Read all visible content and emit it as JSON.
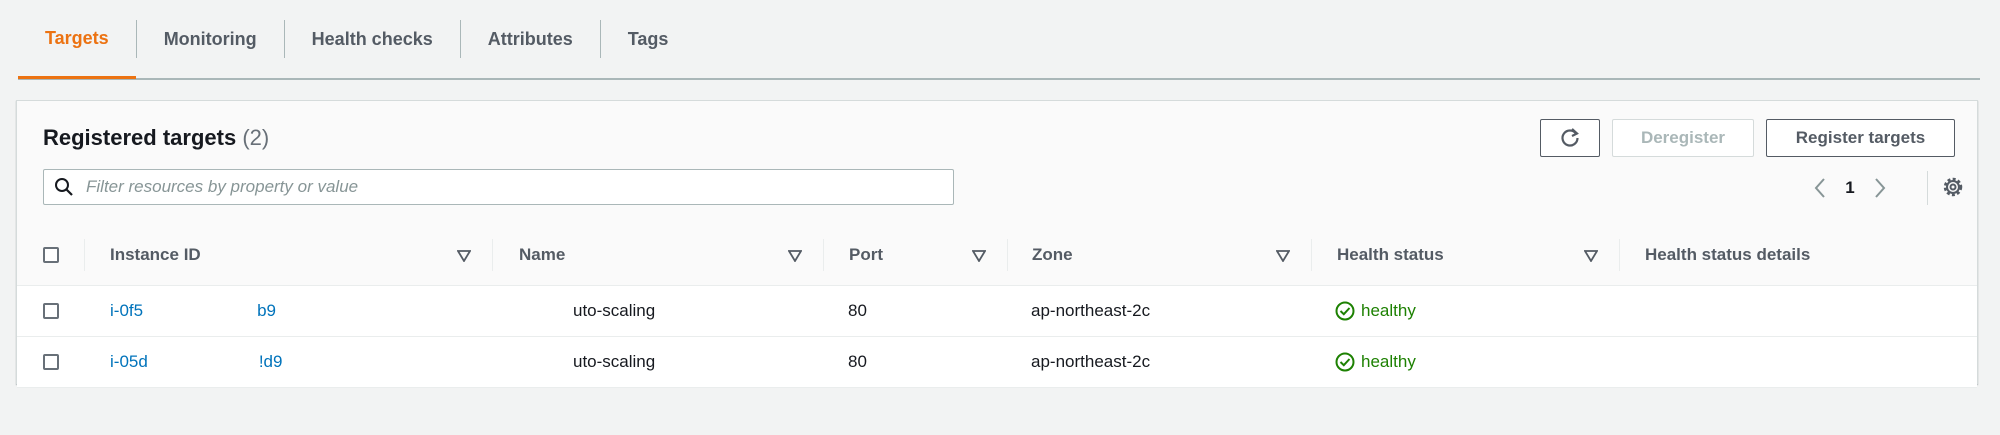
{
  "tabs": [
    {
      "label": "Targets",
      "active": true
    },
    {
      "label": "Monitoring",
      "active": false
    },
    {
      "label": "Health checks",
      "active": false
    },
    {
      "label": "Attributes",
      "active": false
    },
    {
      "label": "Tags",
      "active": false
    }
  ],
  "panel": {
    "title": "Registered targets",
    "count": "(2)"
  },
  "buttons": {
    "refresh_icon": "refresh-icon",
    "deregister": "Deregister",
    "register": "Register targets"
  },
  "search": {
    "placeholder": "Filter resources by property or value",
    "value": ""
  },
  "pagination": {
    "current_page": "1"
  },
  "table": {
    "columns": {
      "instance_id": "Instance ID",
      "name": "Name",
      "port": "Port",
      "zone": "Zone",
      "health_status": "Health status",
      "health_status_details": "Health status details"
    },
    "rows": [
      {
        "instance_id_start": "i-0f5",
        "instance_id_end": "b9",
        "name": "uto-scaling",
        "port": "80",
        "zone": "ap-northeast-2c",
        "health_status": "healthy",
        "health_status_details": ""
      },
      {
        "instance_id_start": "i-05d",
        "instance_id_end": "!d9",
        "name": "uto-scaling",
        "port": "80",
        "zone": "ap-northeast-2c",
        "health_status": "healthy",
        "health_status_details": ""
      }
    ]
  },
  "colors": {
    "accent": "#ec7211",
    "link": "#0073bb",
    "healthy": "#1d8102"
  }
}
